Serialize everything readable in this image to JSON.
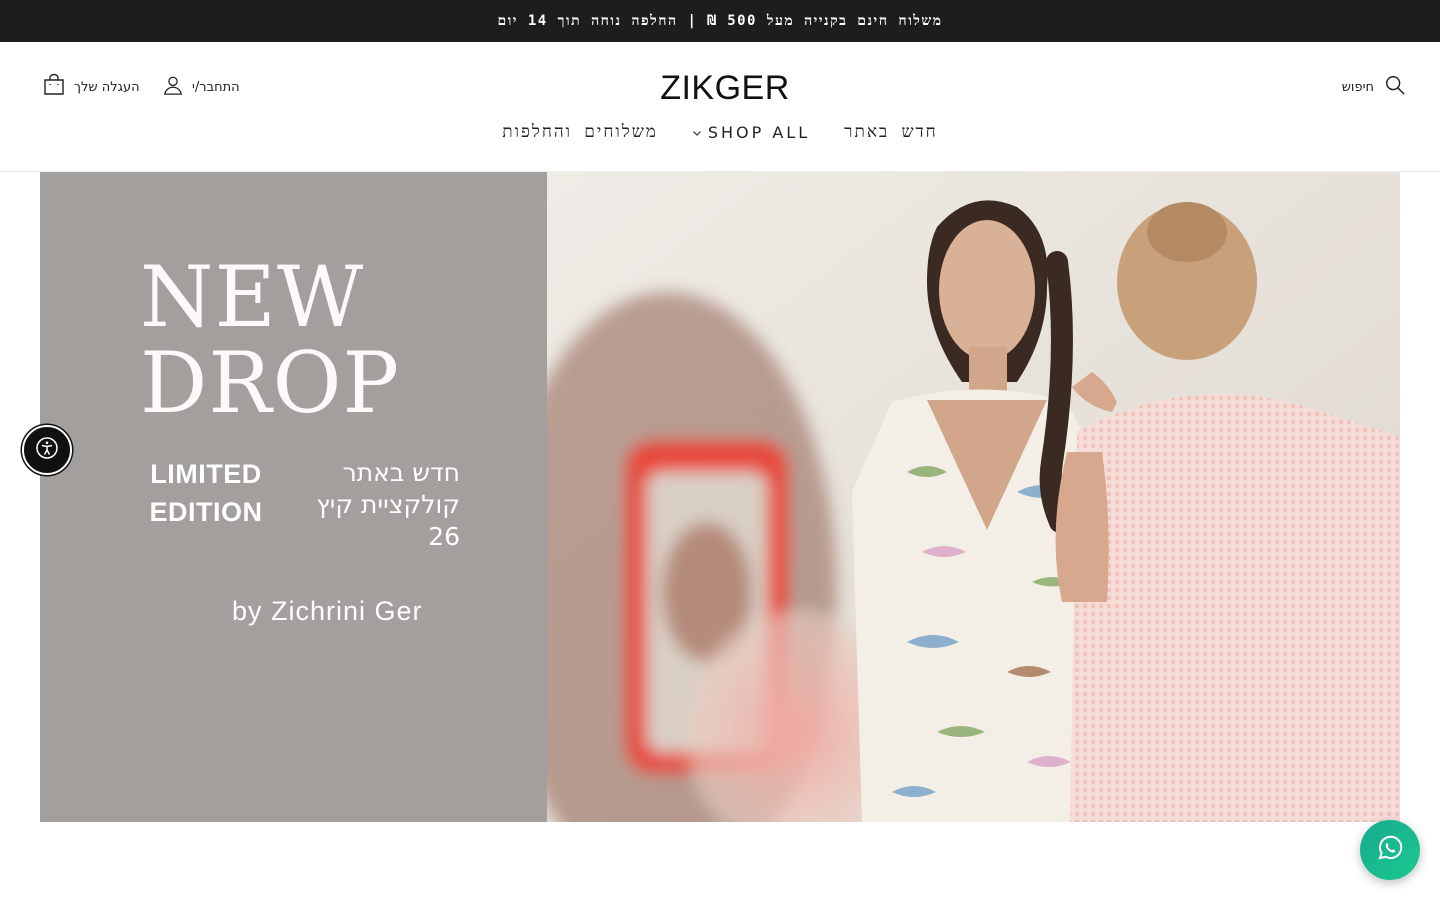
{
  "announcement": {
    "text": "משלוח חינם בקנייה מעל 500 ₪ | החלפה נוחה תוך 14 יום"
  },
  "header": {
    "logo": "ZIKGER",
    "search_label": "חיפוש",
    "account_label": "התחבר/י",
    "cart_label": "העגלה שלך"
  },
  "nav": {
    "items": [
      {
        "label": "חדש באתר"
      },
      {
        "label": "SHOP ALL"
      },
      {
        "label": "משלוחים והחלפות"
      }
    ]
  },
  "hero": {
    "headline_line1": "NEW",
    "headline_line2": "DROP",
    "limited_line1": "LIMITED",
    "limited_line2": "EDITION",
    "hebrew_line1": "חדש באתר",
    "hebrew_line2": "קולקציית קיץ 26",
    "byline": "by Zichrini Ger",
    "panel_color": "#a39f9d"
  },
  "colors": {
    "announcement_bg": "#1d1d1d",
    "whatsapp": "#1cb88f"
  },
  "icons": [
    "search-icon",
    "user-icon",
    "cart-icon",
    "chevron-down-icon",
    "accessibility-icon",
    "whatsapp-icon"
  ]
}
